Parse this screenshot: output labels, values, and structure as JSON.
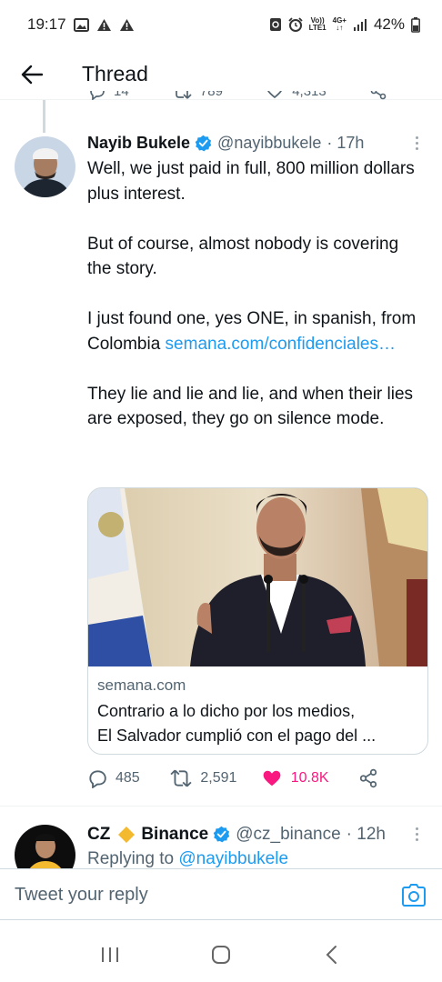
{
  "status_bar": {
    "time": "19:17",
    "volte_top": "Vo))",
    "volte_bottom": "LTE1",
    "network": "4G+",
    "battery": "42%"
  },
  "header": {
    "title": "Thread"
  },
  "previous_tweet": {
    "reply_count": "14",
    "retweet_count": "789",
    "like_count": "4,313"
  },
  "tweet": {
    "name": "Nayib Bukele",
    "handle": "@nayibbukele",
    "time": "· 17h",
    "paragraphs": {
      "p1": "Well, we just paid in full, 800 million dollars plus interest.",
      "p2": "But of course, almost nobody is covering the story.",
      "p3": "I just found one, yes ONE, in spanish, from Colombia",
      "p3_link": "semana.com/confidenciales…",
      "p4": "They lie and lie and lie, and when their lies are exposed, they go on silence mode."
    },
    "card": {
      "domain": "semana.com",
      "title_line1": "Contrario a lo dicho por los medios,",
      "title_line2": "El Salvador cumplió con el pago del ..."
    },
    "actions": {
      "replies": "485",
      "retweets": "2,591",
      "likes": "10.8K"
    }
  },
  "next_tweet": {
    "name_part1": "CZ",
    "name_part2": "Binance",
    "handle": "@cz_binance",
    "time": "· 12h",
    "replying_prefix": "Replying to",
    "replying_to": "@nayibbukele"
  },
  "reply_bar": {
    "placeholder": "Tweet your reply"
  },
  "colors": {
    "accent": "#1d9bf0",
    "like": "#f91880",
    "muted": "#536471",
    "diamond": "#f3ba2f"
  }
}
